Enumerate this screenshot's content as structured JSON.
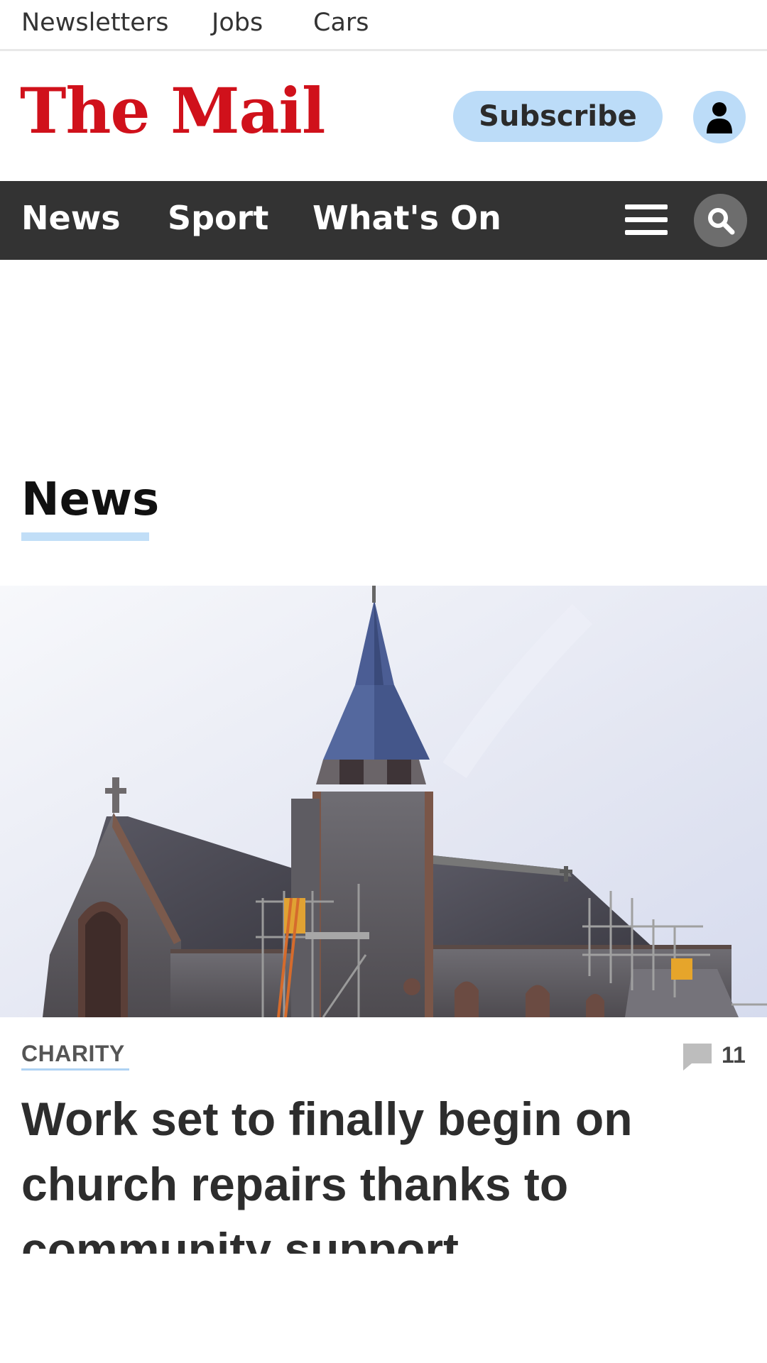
{
  "utility_nav": [
    "Newsletters",
    "Jobs",
    "Cars"
  ],
  "brand": {
    "logo_text": "The Mail",
    "logo_color": "#d0111b"
  },
  "header": {
    "subscribe_label": "Subscribe",
    "account_icon": "person-icon"
  },
  "main_nav": {
    "items": [
      "News",
      "Sport",
      "What's On"
    ],
    "menu_icon": "hamburger-icon",
    "search_icon": "search-icon",
    "background": "#333333"
  },
  "section": {
    "title": "News",
    "accent": "#c1def7"
  },
  "article": {
    "category": "CHARITY",
    "comment_count": "11",
    "headline": "Work set to finally begin on church repairs thanks to community support"
  }
}
